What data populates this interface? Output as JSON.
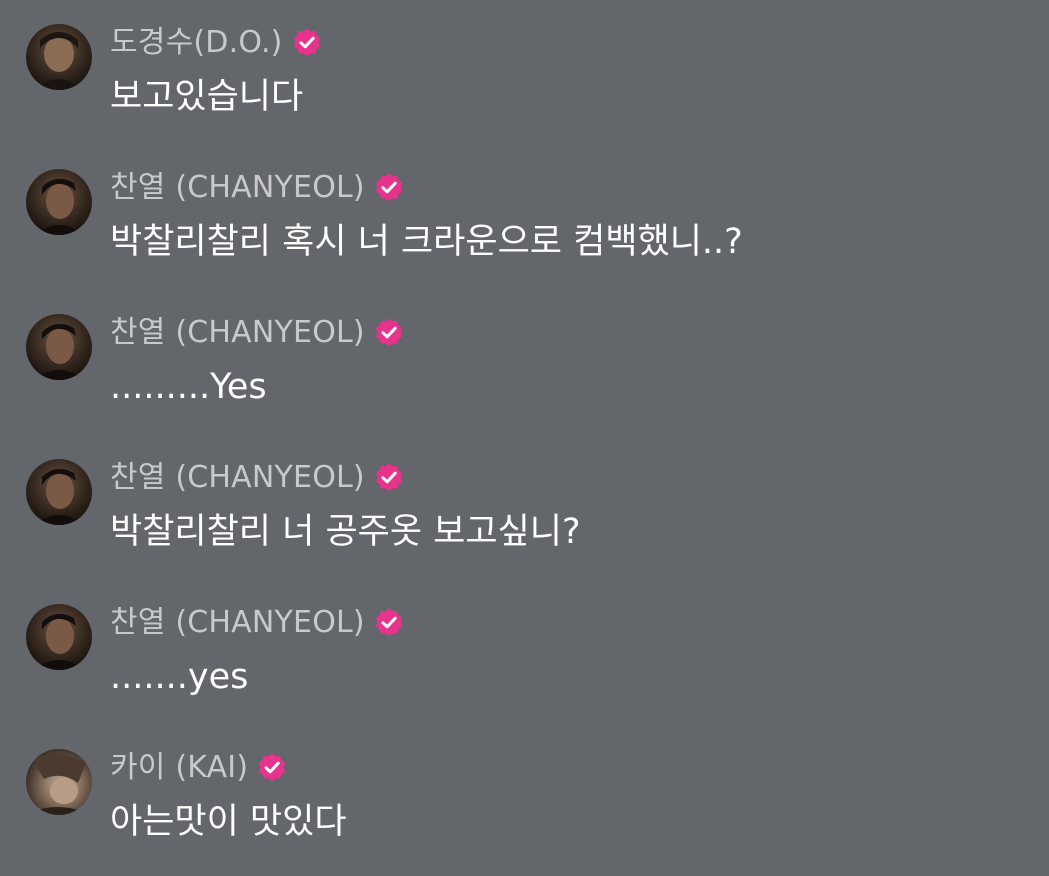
{
  "messages": [
    {
      "author": "도경수(D.O.)",
      "text": "보고있습니다",
      "avatar_icon": "profile-photo-do"
    },
    {
      "author": "찬열 (CHANYEOL)",
      "text": "박찰리찰리 혹시 너 크라운으로 컴백했니..?",
      "avatar_icon": "profile-photo-chanyeol"
    },
    {
      "author": "찬열 (CHANYEOL)",
      "text": ".........Yes",
      "avatar_icon": "profile-photo-chanyeol"
    },
    {
      "author": "찬열 (CHANYEOL)",
      "text": "박찰리찰리 너 공주옷 보고싶니?",
      "avatar_icon": "profile-photo-chanyeol"
    },
    {
      "author": "찬열 (CHANYEOL)",
      "text": ".......yes",
      "avatar_icon": "profile-photo-chanyeol"
    },
    {
      "author": "카이 (KAI)",
      "text": "아는맛이 맛있다",
      "avatar_icon": "profile-photo-kai"
    }
  ],
  "badge_icon": "verified-badge-icon",
  "colors": {
    "background": "#63666a",
    "author_text": "#c7c9cc",
    "message_text": "#ffffff",
    "badge": "#e8338c"
  }
}
